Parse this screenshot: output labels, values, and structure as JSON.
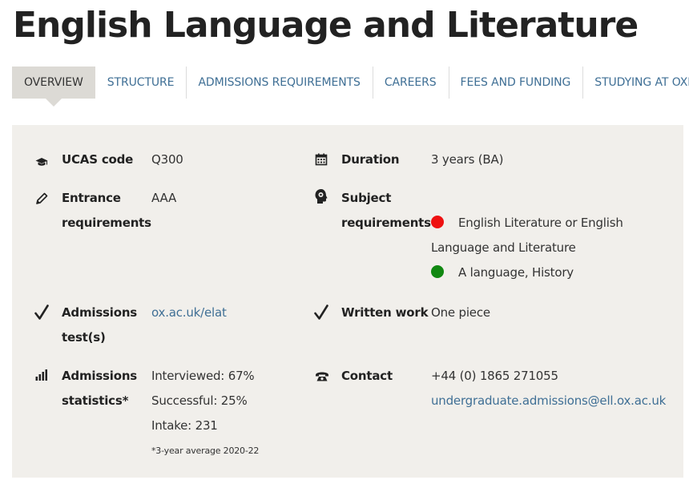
{
  "page_title": "English Language and Literature",
  "tabs": [
    {
      "label": "OVERVIEW",
      "active": true
    },
    {
      "label": "STRUCTURE"
    },
    {
      "label": "ADMISSIONS REQUIREMENTS"
    },
    {
      "label": "CAREERS"
    },
    {
      "label": "FEES AND FUNDING"
    },
    {
      "label": "STUDYING AT OXFORD"
    }
  ],
  "facts": {
    "ucas": {
      "icon": "graduation-cap-icon",
      "label": "UCAS code",
      "value": "Q300"
    },
    "duration": {
      "icon": "calendar-icon",
      "label": "Duration",
      "value": "3 years (BA)"
    },
    "entrance": {
      "icon": "pencil-icon",
      "label_line1": "Entrance",
      "label_line2": "requirements",
      "value": "AAA"
    },
    "subject": {
      "icon": "head-gear-icon",
      "label_line1": "Subject",
      "label_line2": "requirements",
      "essential_line1": "English Literature or English",
      "essential_line2": "Language and Literature",
      "helpful": "A language, History",
      "essential_color": "#ee1111",
      "helpful_color": "#118811"
    },
    "admissions_test": {
      "icon": "checkmark-icon",
      "label_line1": "Admissions",
      "label_line2": "test(s)",
      "value": "ox.ac.uk/elat"
    },
    "written_work": {
      "icon": "checkmark-icon",
      "label": "Written work",
      "value": "One piece"
    },
    "statistics": {
      "icon": "bar-chart-icon",
      "label_line1": "Admissions",
      "label_line2": "statistics*",
      "interviewed": "Interviewed: 67%",
      "successful": "Successful: 25%",
      "intake": "Intake: 231",
      "footnote": "*3-year average 2020-22"
    },
    "contact": {
      "icon": "telephone-icon",
      "label": "Contact",
      "phone": "+44 (0) 1865 271055",
      "email": "undergraduate.admissions@ell.ox.ac.uk"
    }
  },
  "colors": {
    "link": "#3f6f95",
    "panel_bg": "#f1efeb",
    "active_tab_bg": "#dcdad5"
  }
}
